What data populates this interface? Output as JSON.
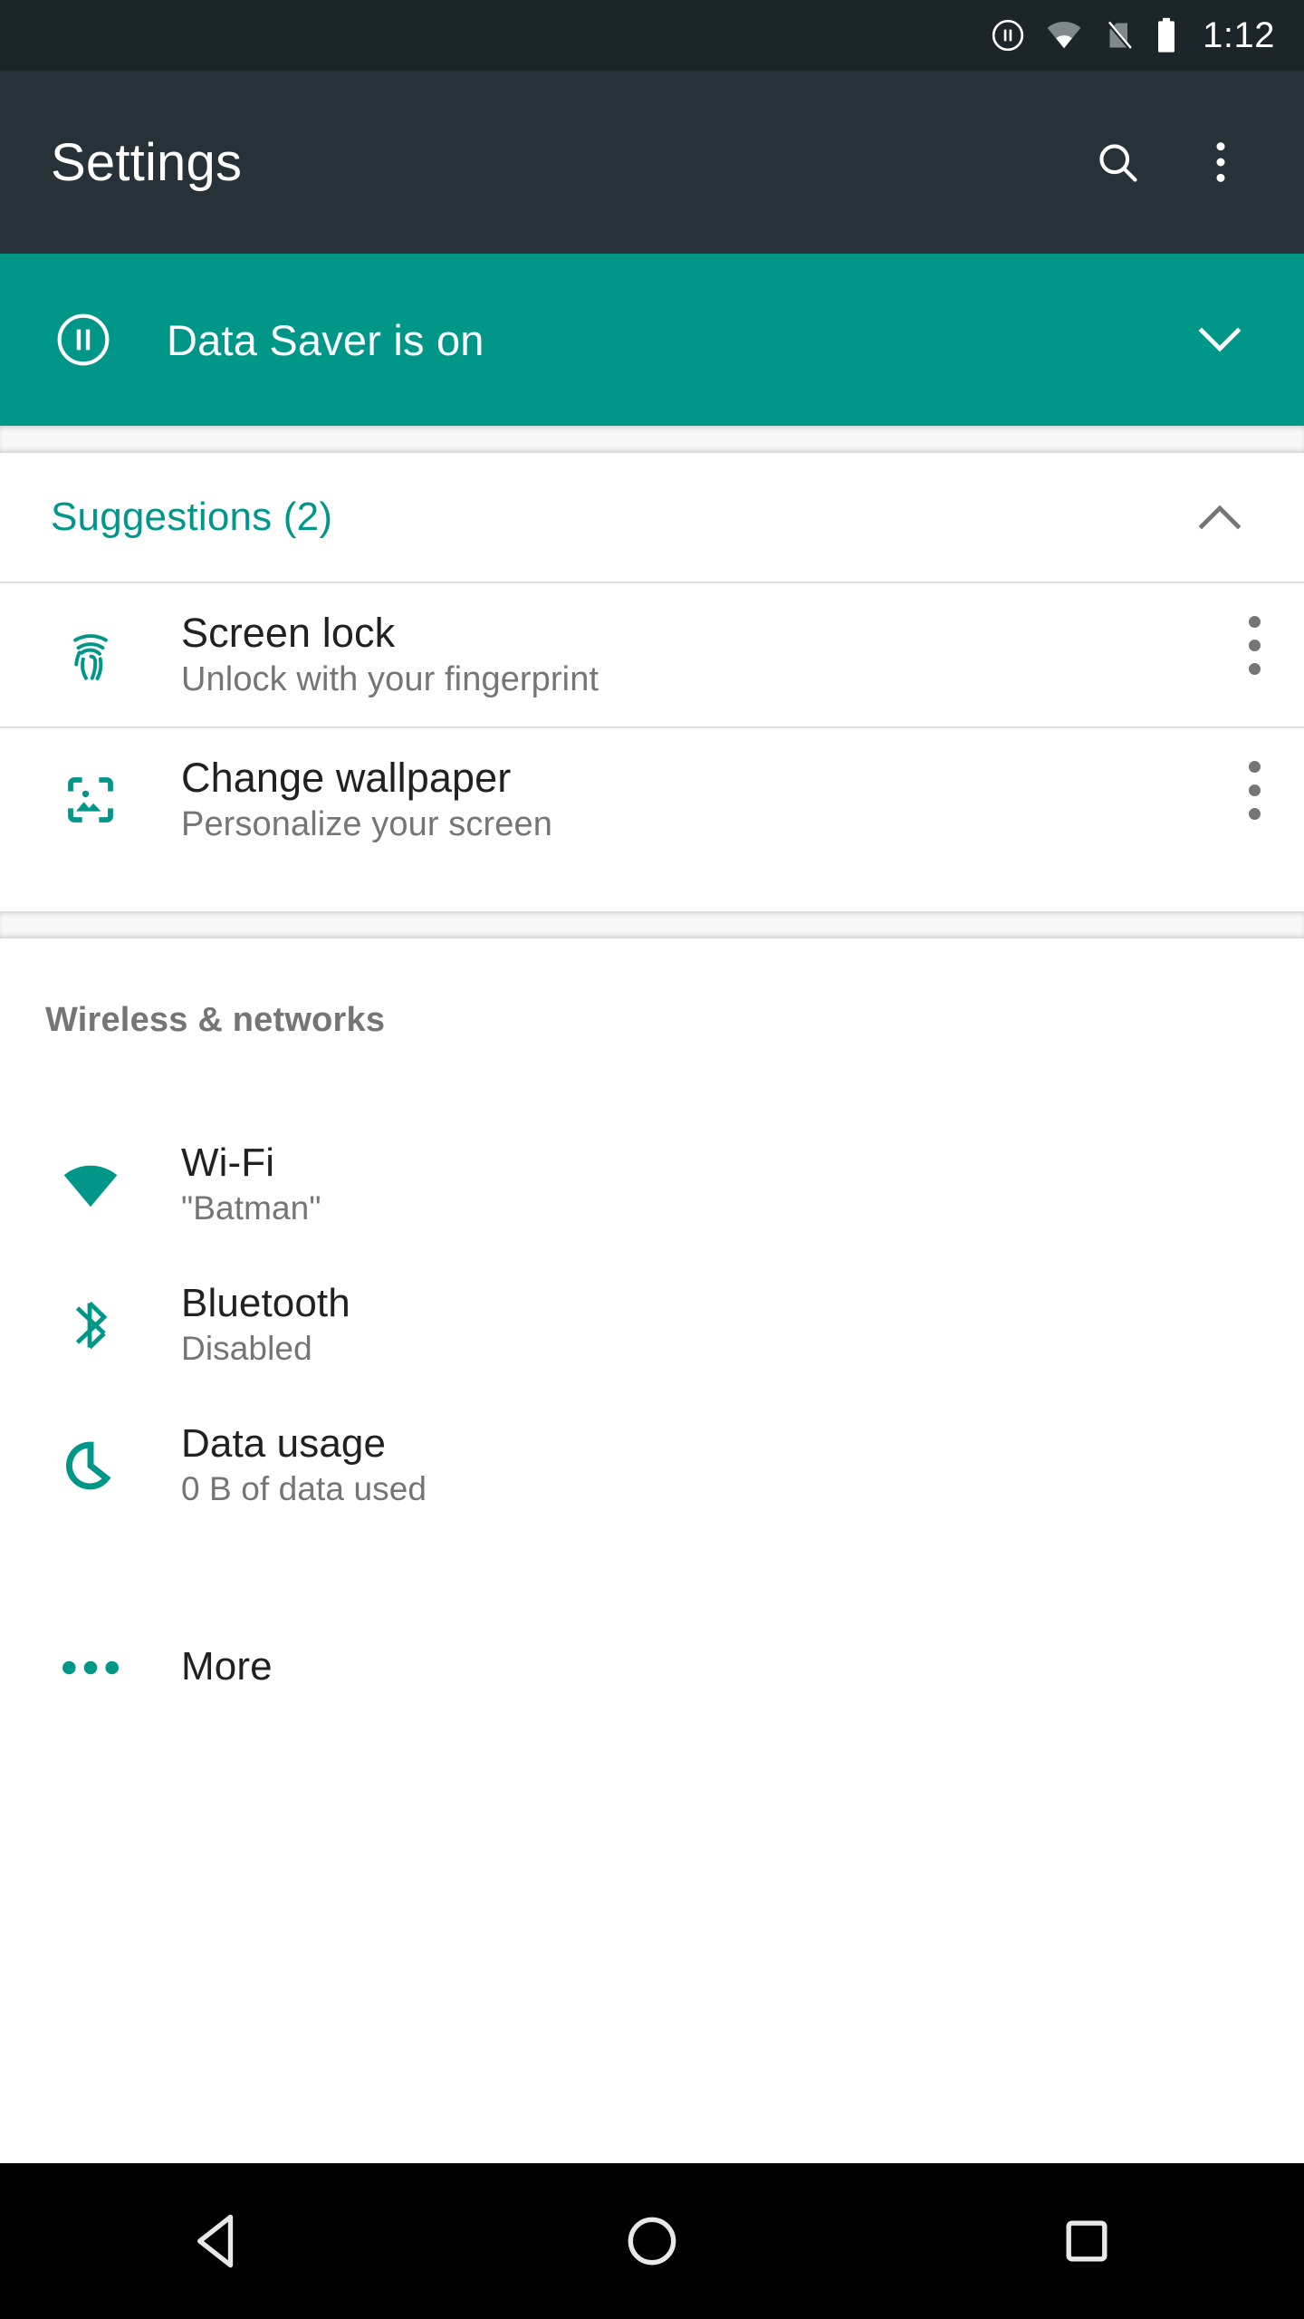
{
  "status_bar": {
    "icons": [
      "data-saver-pause-icon",
      "wifi-signal-icon",
      "no-sim-icon",
      "battery-full-icon"
    ],
    "time": "1:12"
  },
  "app_bar": {
    "title": "Settings",
    "search_icon": "search-icon",
    "overflow_icon": "more-vertical-icon"
  },
  "banner": {
    "icon": "data-saver-pause-icon",
    "text": "Data Saver is on",
    "expand_icon": "chevron-down-icon"
  },
  "suggestions": {
    "title": "Suggestions (2)",
    "collapse_icon": "chevron-up-icon",
    "items": [
      {
        "icon": "fingerprint-icon",
        "title": "Screen lock",
        "subtitle": "Unlock with your fingerprint",
        "overflow_icon": "more-vertical-icon"
      },
      {
        "icon": "wallpaper-icon",
        "title": "Change wallpaper",
        "subtitle": "Personalize your screen",
        "overflow_icon": "more-vertical-icon"
      }
    ]
  },
  "wireless_section": {
    "header": "Wireless & networks",
    "items": [
      {
        "icon": "wifi-icon",
        "title": "Wi-Fi",
        "subtitle": "\"Batman\""
      },
      {
        "icon": "bluetooth-icon",
        "title": "Bluetooth",
        "subtitle": "Disabled"
      },
      {
        "icon": "data-usage-icon",
        "title": "Data usage",
        "subtitle": "0 B of data used"
      },
      {
        "icon": "more-horizontal-icon",
        "title": "More",
        "subtitle": ""
      }
    ]
  },
  "nav_bar": {
    "back": "back-triangle-icon",
    "home": "home-circle-icon",
    "recents": "recents-square-icon"
  },
  "colors": {
    "accent_teal": "#009688",
    "app_bar": "#263238",
    "status_bar": "#1c2529",
    "nav_bar": "#000000",
    "title_text": "#212121",
    "subtitle_text": "#757575"
  }
}
